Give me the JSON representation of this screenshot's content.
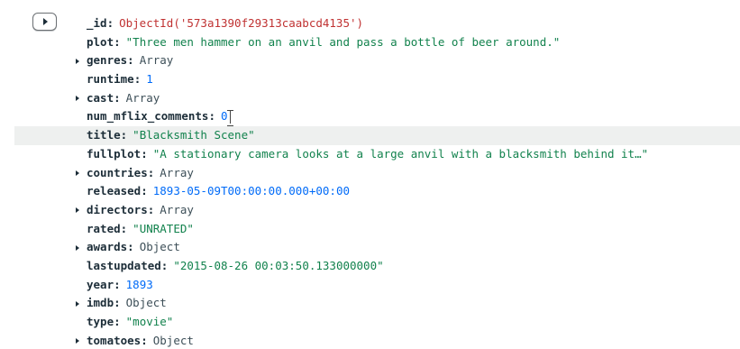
{
  "document": {
    "fields": [
      {
        "key": "_id",
        "value": "ObjectId('573a1390f29313caabcd4135')",
        "kind": "oid",
        "expandable": false
      },
      {
        "key": "plot",
        "value": "\"Three men hammer on an anvil and pass a bottle of beer around.\"",
        "kind": "str",
        "expandable": false
      },
      {
        "key": "genres",
        "value": "Array",
        "kind": "type",
        "expandable": true
      },
      {
        "key": "runtime",
        "value": "1",
        "kind": "num",
        "expandable": false
      },
      {
        "key": "cast",
        "value": "Array",
        "kind": "type",
        "expandable": true
      },
      {
        "key": "num_mflix_comments",
        "value": "0",
        "kind": "num",
        "expandable": false
      },
      {
        "key": "title",
        "value": "\"Blacksmith Scene\"",
        "kind": "str",
        "expandable": false
      },
      {
        "key": "fullplot",
        "value": "\"A stationary camera looks at a large anvil with a blacksmith behind it…\"",
        "kind": "str",
        "expandable": false
      },
      {
        "key": "countries",
        "value": "Array",
        "kind": "type",
        "expandable": true
      },
      {
        "key": "released",
        "value": "1893-05-09T00:00:00.000+00:00",
        "kind": "num",
        "expandable": false
      },
      {
        "key": "directors",
        "value": "Array",
        "kind": "type",
        "expandable": true
      },
      {
        "key": "rated",
        "value": "\"UNRATED\"",
        "kind": "str",
        "expandable": false
      },
      {
        "key": "awards",
        "value": "Object",
        "kind": "type",
        "expandable": true
      },
      {
        "key": "lastupdated",
        "value": "\"2015-08-26 00:03:50.133000000\"",
        "kind": "str",
        "expandable": false
      },
      {
        "key": "year",
        "value": "1893",
        "kind": "num",
        "expandable": false
      },
      {
        "key": "imdb",
        "value": "Object",
        "kind": "type",
        "expandable": true
      },
      {
        "key": "type",
        "value": "\"movie\"",
        "kind": "str",
        "expandable": false
      },
      {
        "key": "tomatoes",
        "value": "Object",
        "kind": "type",
        "expandable": true
      }
    ],
    "hovered_field": "title",
    "cursor_after_field": "num_mflix_comments"
  },
  "icons": {
    "expand_document": "caret-right-icon",
    "expand_field": "caret-right-icon",
    "mouse_cursor": "text-cursor-icon"
  },
  "colors": {
    "key": "#1c2d38",
    "string": "#12824d",
    "number": "#016bf8",
    "object_id": "#c03232",
    "type_label": "#3d4f58",
    "hover_row": "#eef0ef"
  }
}
